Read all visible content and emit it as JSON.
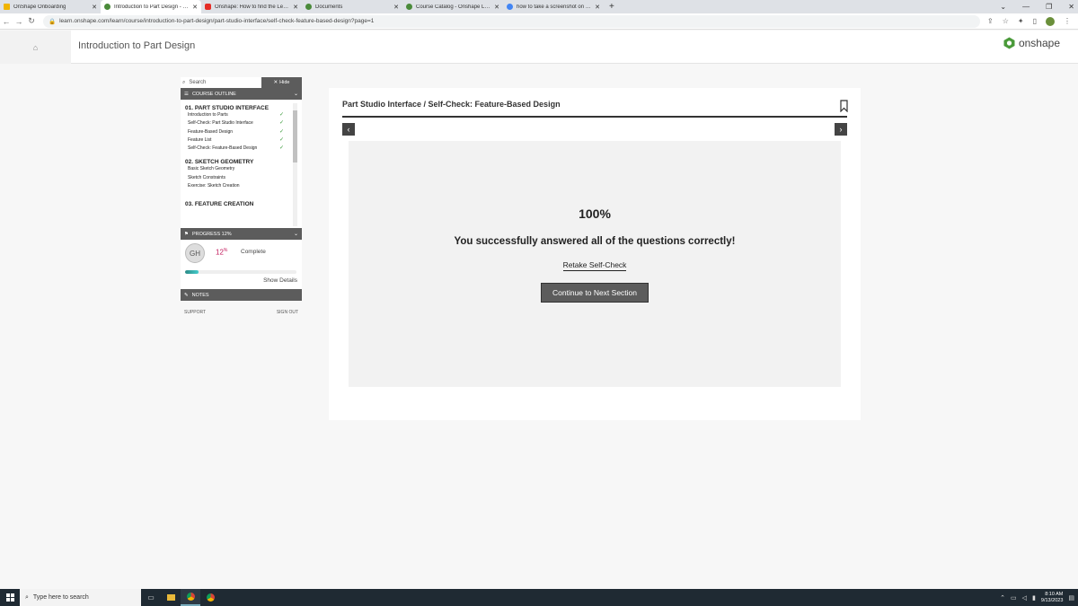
{
  "browser": {
    "tabs": [
      {
        "title": "OnShape Onboarding",
        "fav_color": "#f0b400",
        "active": false
      },
      {
        "title": "Introduction to Part Design - Sel...",
        "fav_color": "#4a8a3a",
        "active": true
      },
      {
        "title": "Onshape: How to find the Learni...",
        "fav_color": "#e52d27",
        "active": false
      },
      {
        "title": "Documents",
        "fav_color": "#4a8a3a",
        "active": false
      },
      {
        "title": "Course Catalog - Onshape Learn...",
        "fav_color": "#4a8a3a",
        "active": false
      },
      {
        "title": "how to take a screenshot on win...",
        "fav_color": "#4285f4",
        "active": false
      }
    ],
    "new_tab_label": "+",
    "url": "learn.onshape.com/learn/course/introduction-to-part-design/part-studio-interface/self-check-feature-based-design?page=1"
  },
  "header": {
    "title": "Introduction to Part Design",
    "logo_text": "onshape"
  },
  "sidebar": {
    "search_placeholder": "Search",
    "hide_label": "Hide",
    "outline_label": "COURSE OUTLINE",
    "sections": [
      {
        "title": "01. PART STUDIO INTERFACE",
        "items": [
          {
            "label": "Introduction to Parts",
            "done": true
          },
          {
            "label": "Self-Check: Part Studio Interface",
            "done": true
          },
          {
            "label": "Feature-Based Design",
            "done": true
          },
          {
            "label": "Feature List",
            "done": true
          },
          {
            "label": "Self-Check: Feature-Based Design",
            "done": true
          }
        ]
      },
      {
        "title": "02. SKETCH GEOMETRY",
        "items": [
          {
            "label": "Basic Sketch Geometry",
            "done": false
          },
          {
            "label": "Sketch Constraints",
            "done": false
          },
          {
            "label": "Exercise: Sketch Creation",
            "done": false
          }
        ]
      },
      {
        "title": "03. FEATURE CREATION",
        "items": []
      }
    ],
    "progress_label": "PROGRESS 12%",
    "avatar_initials": "GH",
    "progress_value": "12",
    "progress_unit": "%",
    "progress_fraction": 0.12,
    "complete_label": "Complete",
    "show_details": "Show Details",
    "notes_label": "NOTES",
    "support_label": "SUPPORT",
    "signout_label": "SIGN OUT"
  },
  "main": {
    "breadcrumb": "Part Studio Interface / Self-Check: Feature-Based Design",
    "score": "100%",
    "message": "You successfully answered all of the questions correctly!",
    "retake_label": "Retake Self-Check",
    "continue_label": "Continue to Next Section"
  },
  "taskbar": {
    "search_placeholder": "Type here to search",
    "time": "8:10 AM",
    "date": "9/13/2023"
  }
}
